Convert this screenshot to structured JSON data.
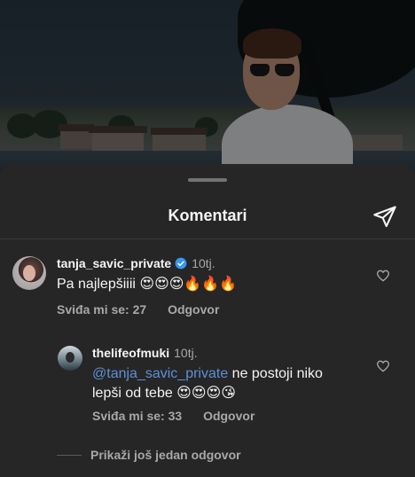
{
  "sheet": {
    "title": "Komentari"
  },
  "comments": [
    {
      "username": "tanja_savic_private",
      "verified": true,
      "time": "10tj.",
      "text": "Pa najlepšiiii 😍😍😍🔥🔥🔥",
      "likes": "Sviđa mi se: 27",
      "reply": "Odgovor"
    }
  ],
  "replies": [
    {
      "username": "thelifeofmuki",
      "time": "10tj.",
      "mention": "@tanja_savic_private",
      "text_line1": " ne postoji niko",
      "text_line2": "lepši od tebe 😍😍😍😘",
      "likes": "Sviđa mi se: 33",
      "reply": "Odgovor"
    }
  ],
  "more_replies": "Prikaži još jedan odgovor",
  "icons": {
    "send": "paper-plane-icon",
    "like": "heart-icon",
    "verified": "verified-badge-icon"
  },
  "colors": {
    "background": "#262626",
    "mention": "#5f8fd6",
    "verified": "#3797f0"
  }
}
